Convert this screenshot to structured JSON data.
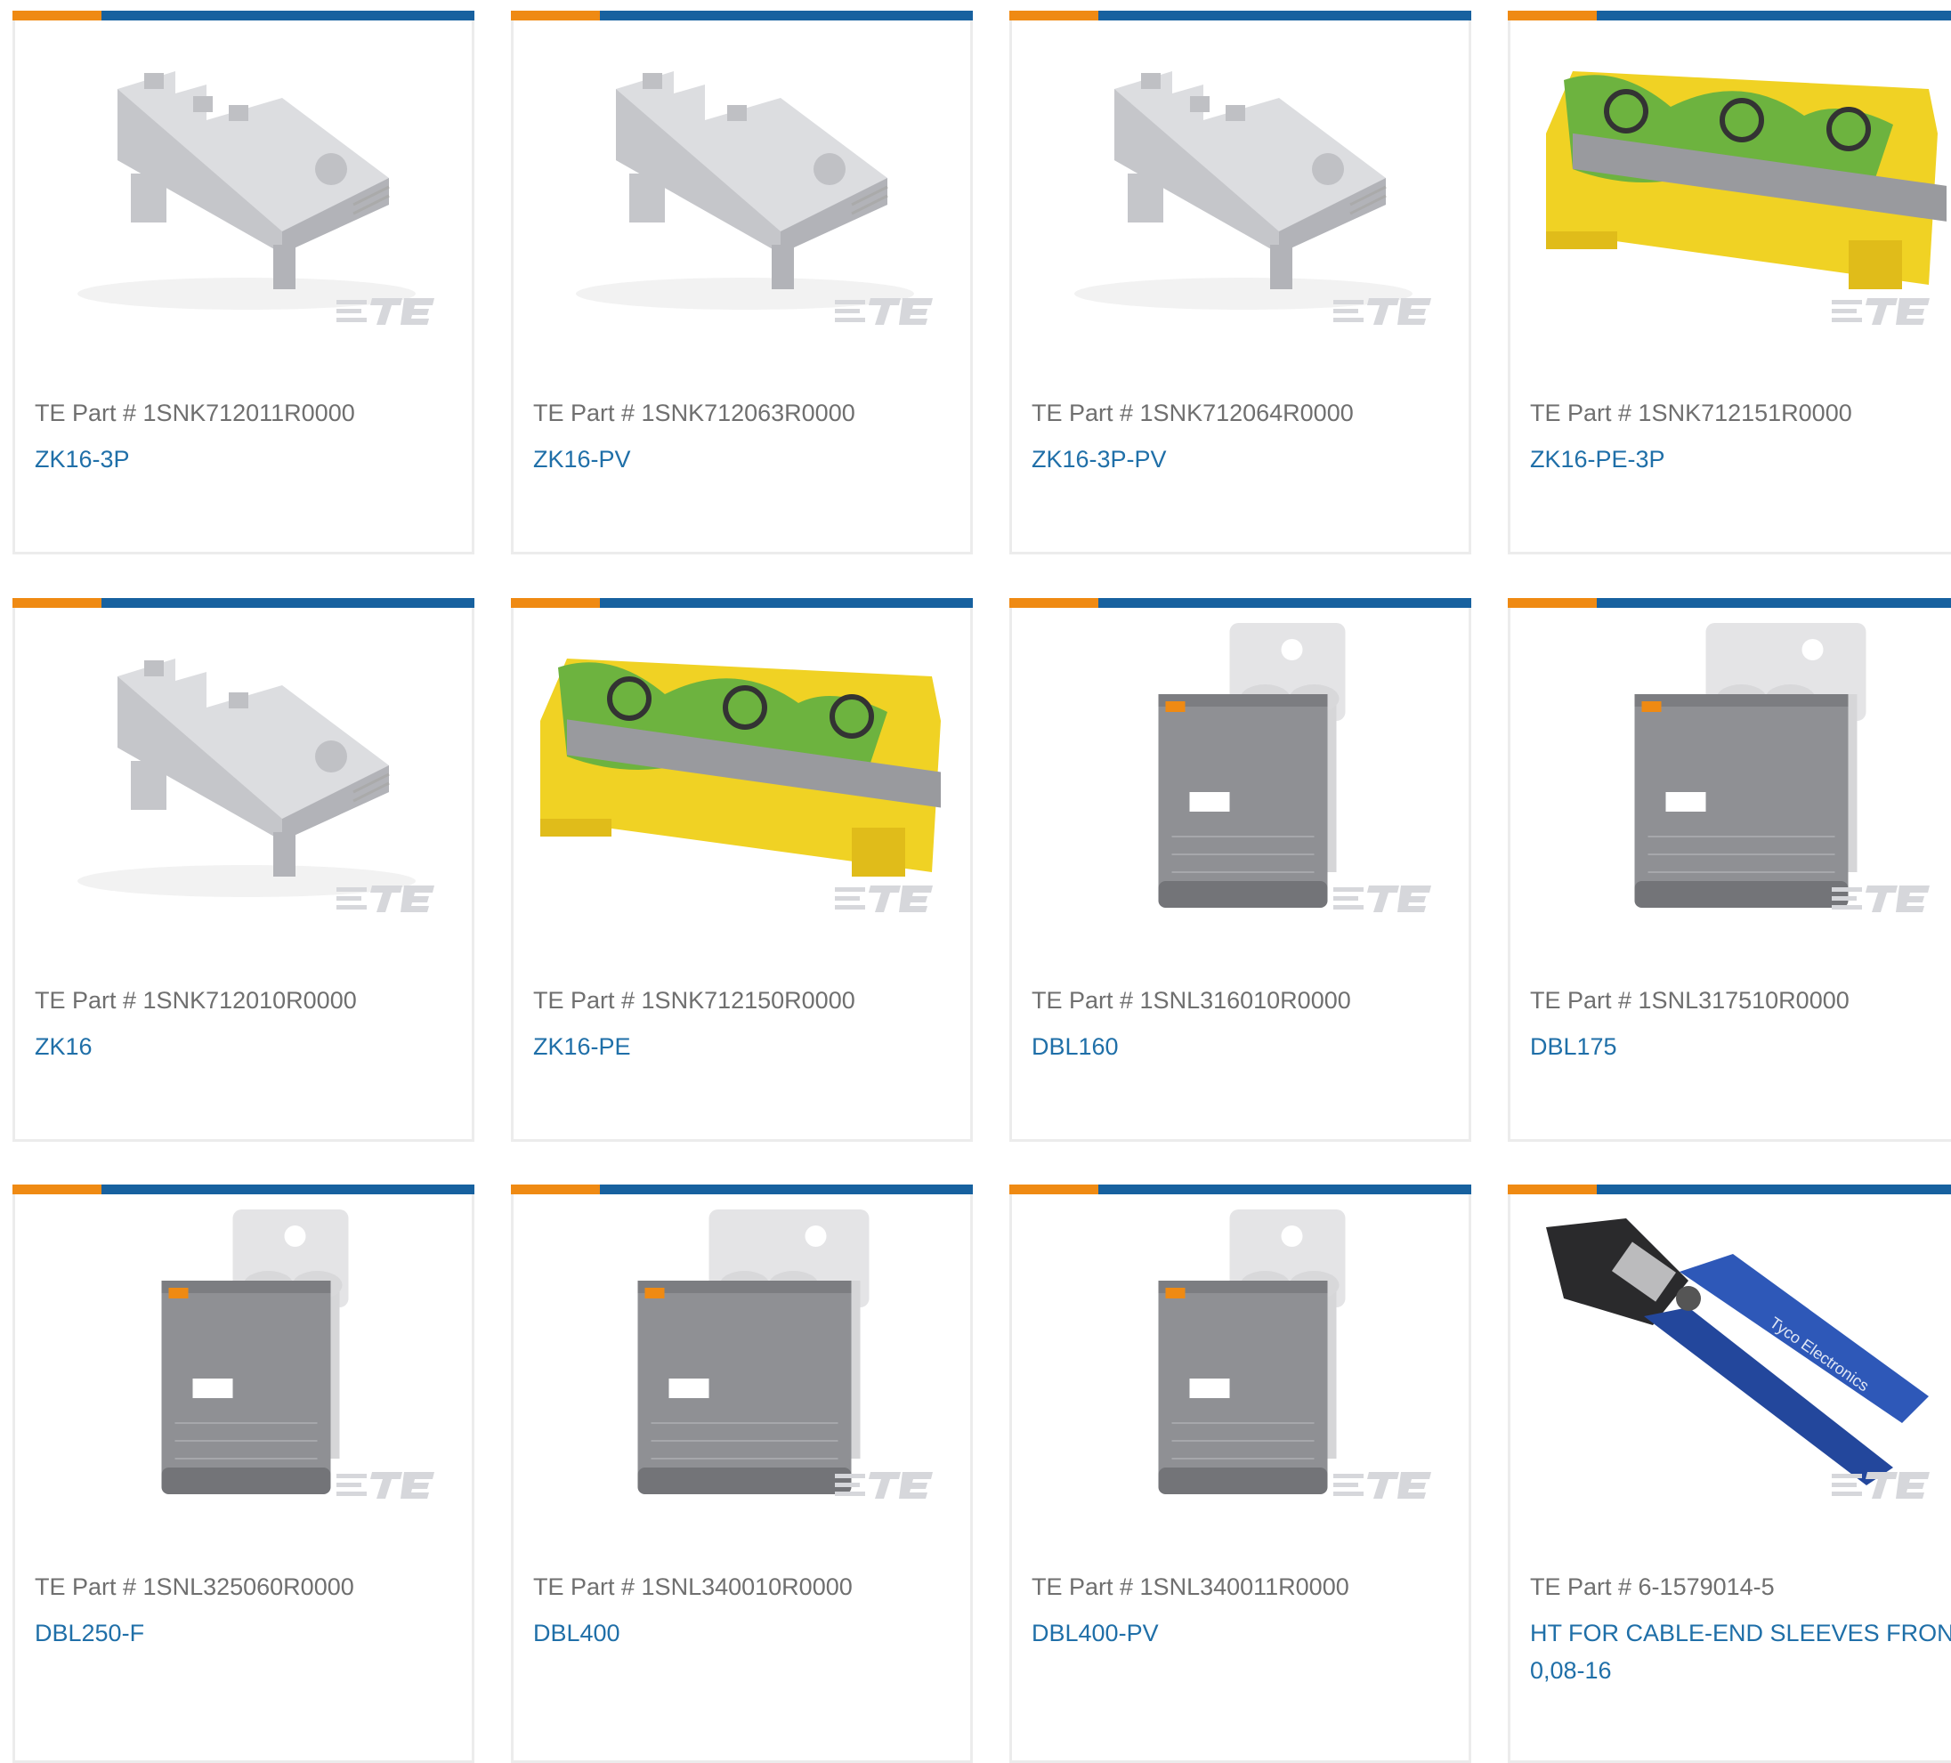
{
  "products": [
    {
      "part_label": "TE Part # 1SNK712011R0000",
      "name": "ZK16-3P",
      "image": "terminal-block-grey-3p"
    },
    {
      "part_label": "TE Part # 1SNK712063R0000",
      "name": "ZK16-PV",
      "image": "terminal-block-grey-pv"
    },
    {
      "part_label": "TE Part # 1SNK712064R0000",
      "name": "ZK16-3P-PV",
      "image": "terminal-block-grey-3p"
    },
    {
      "part_label": "TE Part # 1SNK712151R0000",
      "name": "ZK16-PE-3P",
      "image": "terminal-block-pe-3p"
    },
    {
      "part_label": "TE Part # 1SNK712010R0000",
      "name": "ZK16",
      "image": "terminal-block-grey"
    },
    {
      "part_label": "TE Part # 1SNK712150R0000",
      "name": "ZK16-PE",
      "image": "terminal-block-pe"
    },
    {
      "part_label": "TE Part # 1SNL316010R0000",
      "name": "DBL160",
      "image": "distribution-block"
    },
    {
      "part_label": "TE Part # 1SNL317510R0000",
      "name": "DBL175",
      "image": "distribution-block-wide"
    },
    {
      "part_label": "TE Part # 1SNL325060R0000",
      "name": "DBL250-F",
      "image": "distribution-block"
    },
    {
      "part_label": "TE Part # 1SNL340010R0000",
      "name": "DBL400",
      "image": "distribution-block-wide"
    },
    {
      "part_label": "TE Part # 1SNL340011R0000",
      "name": "DBL400-PV",
      "image": "distribution-block"
    },
    {
      "part_label": "TE Part # 6-1579014-5",
      "name": "HT FOR CABLE-END SLEEVES FRONT",
      "name_line2": "0,08-16",
      "image": "crimp-tool"
    }
  ],
  "watermark": "TE",
  "colors": {
    "accent_orange": "#ef8a13",
    "accent_blue": "#17619f",
    "link": "#1f6fa8",
    "part_text": "#6f6f6f"
  }
}
